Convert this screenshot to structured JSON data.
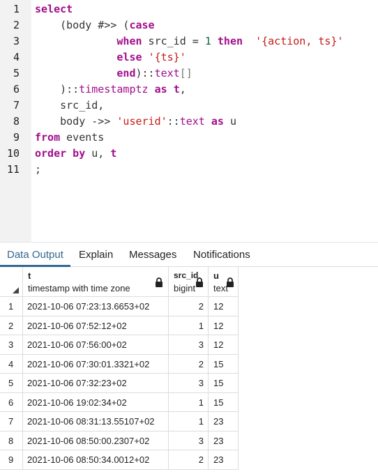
{
  "editor": {
    "line_numbers": [
      "1",
      "2",
      "3",
      "4",
      "5",
      "6",
      "7",
      "8",
      "9",
      "10",
      "11"
    ],
    "lines": [
      [
        {
          "t": "select",
          "c": "kw"
        }
      ],
      [
        {
          "t": "    (body #>> (",
          "c": "plain"
        },
        {
          "t": "case",
          "c": "kw"
        }
      ],
      [
        {
          "t": "             ",
          "c": "plain"
        },
        {
          "t": "when",
          "c": "kw"
        },
        {
          "t": " src_id = ",
          "c": "plain"
        },
        {
          "t": "1",
          "c": "num"
        },
        {
          "t": " ",
          "c": "plain"
        },
        {
          "t": "then",
          "c": "kw"
        },
        {
          "t": "  ",
          "c": "plain"
        },
        {
          "t": "'{action, ts}'",
          "c": "str"
        }
      ],
      [
        {
          "t": "             ",
          "c": "plain"
        },
        {
          "t": "else",
          "c": "kw"
        },
        {
          "t": " ",
          "c": "plain"
        },
        {
          "t": "'{ts}'",
          "c": "str"
        }
      ],
      [
        {
          "t": "             ",
          "c": "plain"
        },
        {
          "t": "end",
          "c": "kw"
        },
        {
          "t": ")::",
          "c": "plain"
        },
        {
          "t": "text",
          "c": "typ"
        },
        {
          "t": "[]",
          "c": "op"
        }
      ],
      [
        {
          "t": "    )::",
          "c": "plain"
        },
        {
          "t": "timestamptz",
          "c": "typ"
        },
        {
          "t": " ",
          "c": "plain"
        },
        {
          "t": "as",
          "c": "kw"
        },
        {
          "t": " ",
          "c": "plain"
        },
        {
          "t": "t",
          "c": "kw"
        },
        {
          "t": ",",
          "c": "plain"
        }
      ],
      [
        {
          "t": "    src_id,",
          "c": "plain"
        }
      ],
      [
        {
          "t": "    body ->> ",
          "c": "plain"
        },
        {
          "t": "'userid'",
          "c": "str"
        },
        {
          "t": "::",
          "c": "plain"
        },
        {
          "t": "text",
          "c": "typ"
        },
        {
          "t": " ",
          "c": "plain"
        },
        {
          "t": "as",
          "c": "kw"
        },
        {
          "t": " u",
          "c": "plain"
        }
      ],
      [
        {
          "t": "from",
          "c": "kw"
        },
        {
          "t": " events",
          "c": "plain"
        }
      ],
      [
        {
          "t": "order by",
          "c": "kw"
        },
        {
          "t": " u, ",
          "c": "plain"
        },
        {
          "t": "t",
          "c": "kw"
        }
      ],
      [
        {
          "t": ";",
          "c": "plain"
        }
      ]
    ]
  },
  "tabs": [
    {
      "label": "Data Output",
      "active": true
    },
    {
      "label": "Explain",
      "active": false
    },
    {
      "label": "Messages",
      "active": false
    },
    {
      "label": "Notifications",
      "active": false
    }
  ],
  "grid": {
    "columns": [
      {
        "name": "t",
        "type": "timestamp with time zone",
        "locked": true
      },
      {
        "name": "src_id",
        "type": "bigint",
        "locked": true
      },
      {
        "name": "u",
        "type": "text",
        "locked": true
      }
    ],
    "rows": [
      {
        "idx": "1",
        "t": "2021-10-06 07:23:13.6653+02",
        "src_id": "2",
        "u": "12"
      },
      {
        "idx": "2",
        "t": "2021-10-06 07:52:12+02",
        "src_id": "1",
        "u": "12"
      },
      {
        "idx": "3",
        "t": "2021-10-06 07:56:00+02",
        "src_id": "3",
        "u": "12"
      },
      {
        "idx": "4",
        "t": "2021-10-06 07:30:01.3321+02",
        "src_id": "2",
        "u": "15"
      },
      {
        "idx": "5",
        "t": "2021-10-06 07:32:23+02",
        "src_id": "3",
        "u": "15"
      },
      {
        "idx": "6",
        "t": "2021-10-06 19:02:34+02",
        "src_id": "1",
        "u": "15"
      },
      {
        "idx": "7",
        "t": "2021-10-06 08:31:13.55107+02",
        "src_id": "1",
        "u": "23"
      },
      {
        "idx": "8",
        "t": "2021-10-06 08:50:00.2307+02",
        "src_id": "3",
        "u": "23"
      },
      {
        "idx": "9",
        "t": "2021-10-06 08:50:34.0012+02",
        "src_id": "2",
        "u": "23"
      }
    ]
  },
  "colors": {
    "accent": "#326690",
    "keyword": "#a00d8b",
    "string": "#c41a16",
    "number": "#116644"
  },
  "icons": {
    "lock": "lock-icon",
    "sort": "sort-corner-icon"
  }
}
